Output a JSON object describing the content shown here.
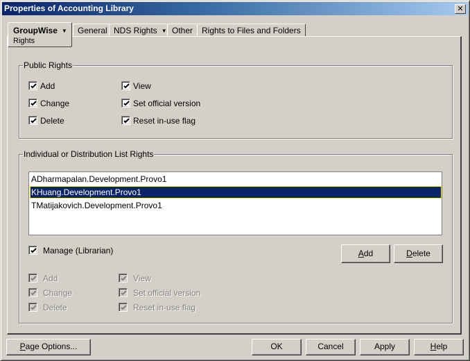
{
  "window": {
    "title": "Properties of Accounting Library",
    "close_label": "✕"
  },
  "tabs": [
    {
      "label": "GroupWise",
      "sublabel": "Rights",
      "has_dropdown": true,
      "active": true
    },
    {
      "label": "General",
      "has_dropdown": false,
      "active": false
    },
    {
      "label": "NDS Rights",
      "has_dropdown": true,
      "active": false
    },
    {
      "label": "Other",
      "has_dropdown": false,
      "active": false
    },
    {
      "label": "Rights to Files and Folders",
      "has_dropdown": false,
      "active": false
    }
  ],
  "dropdown_arrow": "▼",
  "public_rights": {
    "title": "Public Rights",
    "checkboxes": [
      {
        "label": "Add",
        "checked": true
      },
      {
        "label": "Change",
        "checked": true
      },
      {
        "label": "Delete",
        "checked": true
      },
      {
        "label": "View",
        "checked": true
      },
      {
        "label": "Set official version",
        "checked": true
      },
      {
        "label": "Reset in-use flag",
        "checked": true
      }
    ]
  },
  "individual_rights": {
    "title": "Individual or Distribution List Rights",
    "list": [
      {
        "name": "ADharmapalan.Development.Provo1",
        "selected": false
      },
      {
        "name": "KHuang.Development.Provo1",
        "selected": true
      },
      {
        "name": "TMatijakovich.Development.Provo1",
        "selected": false
      }
    ],
    "manage": {
      "label": "Manage (Librarian)",
      "checked": true
    },
    "add_button": {
      "mnemonic": "A",
      "rest": "dd"
    },
    "delete_button": {
      "mnemonic": "D",
      "rest": "elete"
    },
    "checkboxes": [
      {
        "label": "Add",
        "checked": true,
        "disabled": true
      },
      {
        "label": "Change",
        "checked": true,
        "disabled": true
      },
      {
        "label": "Delete",
        "checked": true,
        "disabled": true
      },
      {
        "label": "View",
        "checked": true,
        "disabled": true
      },
      {
        "label": "Set official version",
        "checked": true,
        "disabled": true
      },
      {
        "label": "Reset in-use flag",
        "checked": true,
        "disabled": true
      }
    ]
  },
  "footer": {
    "page_options": {
      "mnemonic": "P",
      "rest": "age Options..."
    },
    "ok": "OK",
    "cancel": "Cancel",
    "apply": "Apply",
    "help": {
      "mnemonic": "H",
      "rest": "elp"
    }
  }
}
